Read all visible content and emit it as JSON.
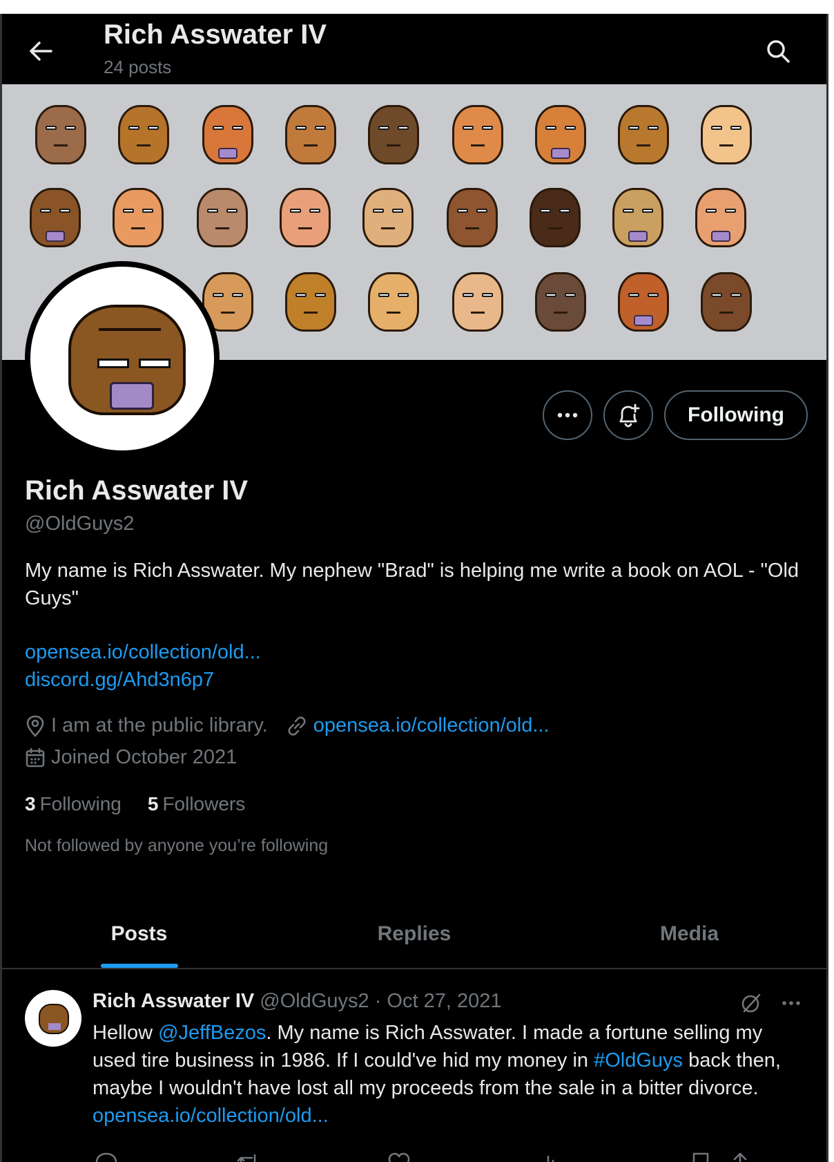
{
  "header": {
    "title": "Rich Asswater IV",
    "post_count": "24 posts"
  },
  "profile": {
    "name": "Rich Asswater IV",
    "handle": "@OldGuys2",
    "bio": "My name is Rich Asswater. My nephew \"Brad\" is helping me write a book on AOL - \"Old Guys\"",
    "bio_links": [
      "opensea.io/collection/old...",
      "discord.gg/Ahd3n6p7"
    ],
    "location": "I am at the public library.",
    "website": "opensea.io/collection/old...",
    "joined": "Joined October 2021",
    "following_count": "3",
    "following_label": "Following",
    "followers_count": "5",
    "followers_label": "Followers",
    "not_followed": "Not followed by anyone you’re following",
    "follow_button": "Following"
  },
  "tabs": [
    {
      "label": "Posts",
      "active": true
    },
    {
      "label": "Replies",
      "active": false
    },
    {
      "label": "Media",
      "active": false
    }
  ],
  "post": {
    "author": "Rich Asswater IV",
    "meta": "@OldGuys2 · Oct 27, 2021",
    "text_1": "Hellow ",
    "mention": "@JeffBezos",
    "text_2": ". My name is Rich Asswater. I made a fortune selling my used tire business in 1986. If I could've hid my money in ",
    "hashtag": "#OldGuys",
    "text_3": " back then, maybe I wouldn't have lost all my proceeds from the sale in a bitter divorce. ",
    "link": "opensea.io/collection/old..."
  },
  "colors": {
    "accent": "#1d9bf0",
    "background": "#000000",
    "muted": "#71767b"
  }
}
